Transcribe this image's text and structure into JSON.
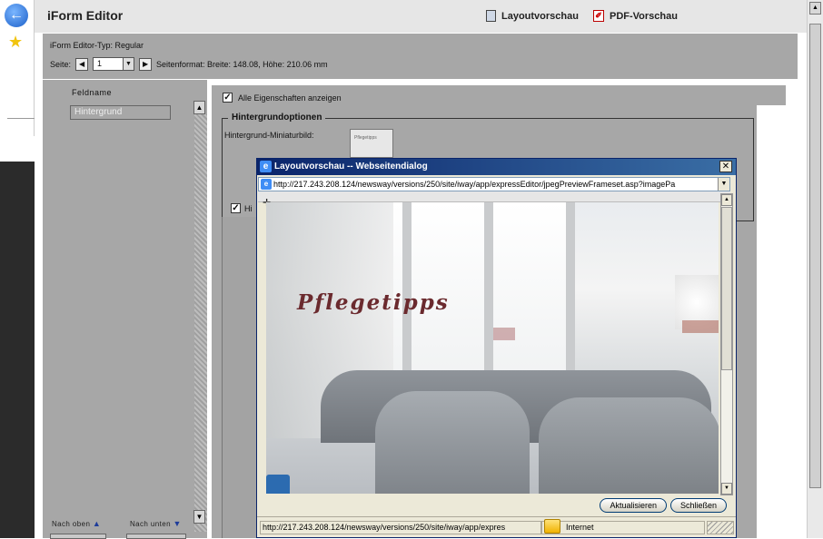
{
  "editor": {
    "title": "iForm Editor",
    "layout_preview": "Layoutvorschau",
    "pdf_preview": "PDF-Vorschau",
    "type_line": "iForm Editor-Typ:  Regular",
    "page_label": "Seite:",
    "page_value": "1",
    "format_text": "Seitenformat: Breite: 148.08, Höhe: 210.06 mm"
  },
  "fields": {
    "header": "Feldname",
    "current": "Hintergrund",
    "nav_up": "Nach oben",
    "nav_down": "Nach unten"
  },
  "properties": {
    "show_all": "Alle Eigenschaften anzeigen",
    "group_title": "Hintergrundoptionen",
    "thumb_label": "Hintergrund-Miniaturbild:",
    "thumb_text": "Pflegetipps",
    "checkbox2_label": "Hi"
  },
  "dialog": {
    "title": "Layoutvorschau -- Webseitendialog",
    "url": "http://217.243.208.124/newsway/versions/250/site/iway/app/expressEditor/jpegPreviewFrameset.asp?imagePa",
    "preview_text": "Pflegetipps",
    "refresh": "Aktualisieren",
    "close": "Schließen",
    "status_url": "http://217.243.208.124/newsway/versions/250/site/iway/app/expres",
    "zone": "Internet"
  }
}
